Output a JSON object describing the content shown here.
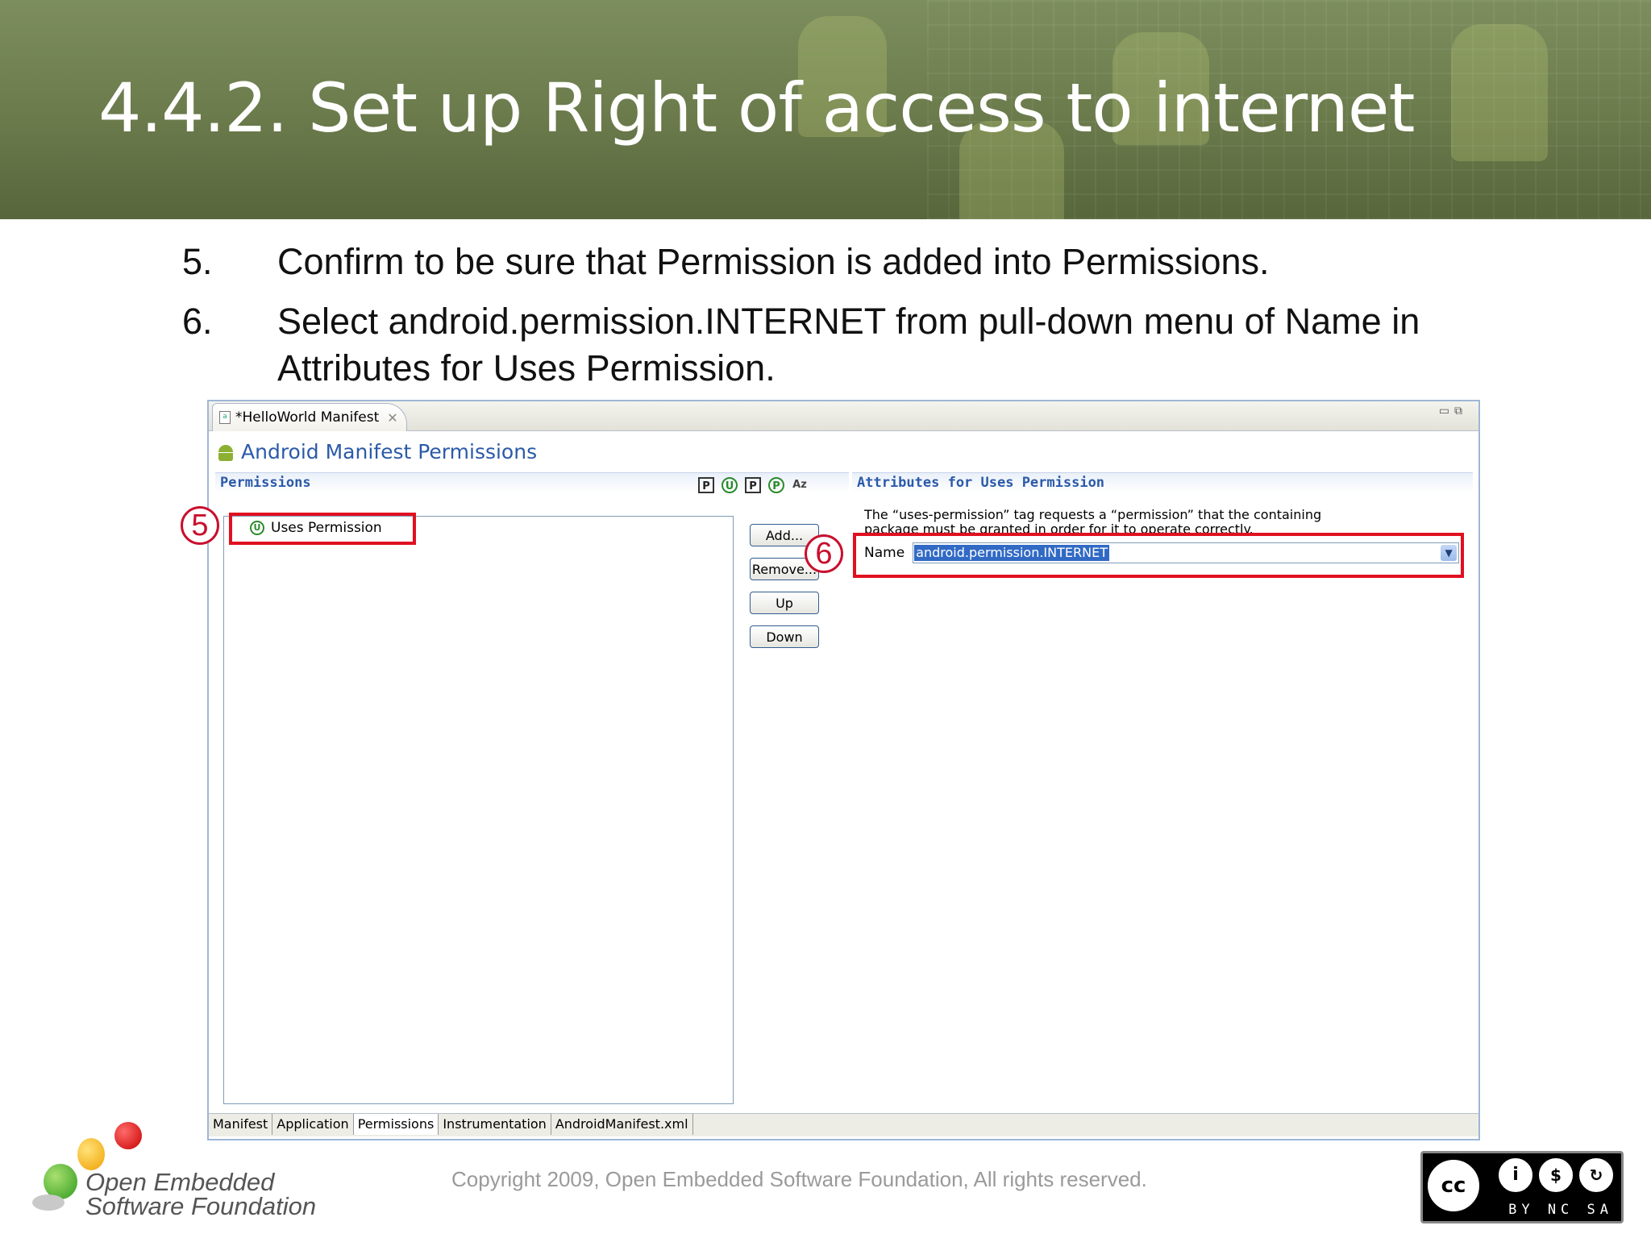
{
  "slide": {
    "title": "4.4.2. Set up Right of access to internet",
    "steps": [
      {
        "num": "5.",
        "text": "Confirm to be sure that Permission is added into Permissions."
      },
      {
        "num": "6.",
        "text": "Select android.permission.INTERNET from pull-down menu of Name in Attributes for Uses Permission."
      }
    ]
  },
  "editor": {
    "tab_title": "*HelloWorld Manifest",
    "page_title": "Android Manifest Permissions",
    "permissions_section": "Permissions",
    "tool_icons": [
      "P",
      "U",
      "P",
      "P",
      "Az"
    ],
    "tree_item": "Uses Permission",
    "buttons": {
      "add": "Add...",
      "remove": "Remove...",
      "up": "Up",
      "down": "Down"
    },
    "attributes_section": "Attributes for Uses Permission",
    "attributes_desc": "The “uses-permission” tag requests a “permission” that the containing package must be granted in order for it to operate correctly.",
    "name_label": "Name",
    "name_value": "android.permission.INTERNET",
    "bottom_tabs": [
      "Manifest",
      "Application",
      "Permissions",
      "Instrumentation",
      "AndroidManifest.xml"
    ],
    "active_tab": "Permissions"
  },
  "callouts": {
    "first": "5",
    "second": "6"
  },
  "footer": {
    "copyright": "Copyright 2009, Open Embedded Software Foundation, All rights reserved.",
    "logo_line1": "Open Embedded",
    "logo_line2": "Software Foundation",
    "license_labels": "BY NC SA"
  },
  "colors": {
    "callout_red": "#e01020",
    "link_blue": "#2b5aa8",
    "selection_blue": "#316ac5",
    "banner_green": "#6a7a4b"
  }
}
